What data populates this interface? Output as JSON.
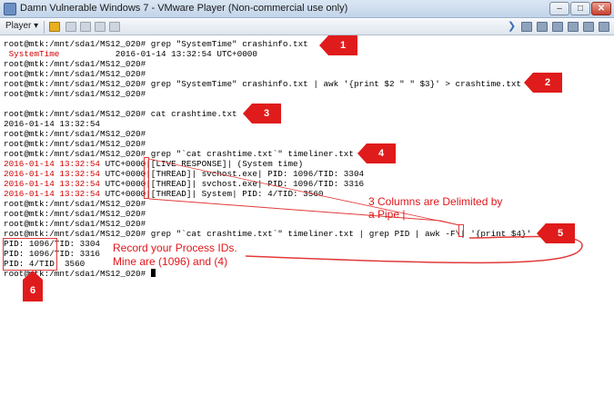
{
  "window": {
    "title": "Damn Vulnerable Windows 7 - VMware Player (Non-commercial use only)",
    "minimize_label": "–",
    "maximize_label": "□",
    "close_label": "✕"
  },
  "toolbar": {
    "player_menu": "Player ▾"
  },
  "terminal": {
    "lines": [
      "root@mtk:/mnt/sda1/MS12_020# grep \"SystemTime\" crashinfo.txt",
      "",
      "root@mtk:/mnt/sda1/MS12_020#",
      "root@mtk:/mnt/sda1/MS12_020#",
      "root@mtk:/mnt/sda1/MS12_020# grep \"SystemTime\" crashinfo.txt | awk '{print $2 \" \" $3}' > crashtime.txt",
      "root@mtk:/mnt/sda1/MS12_020#",
      "root@mtk:/mnt/sda1/MS12_020# cat crashtime.txt",
      "2016-01-14 13:32:54",
      "root@mtk:/mnt/sda1/MS12_020#",
      "root@mtk:/mnt/sda1/MS12_020#",
      "root@mtk:/mnt/sda1/MS12_020# grep \"`cat crashtime.txt`\" timeliner.txt",
      "",
      "",
      "",
      "",
      "root@mtk:/mnt/sda1/MS12_020#",
      "root@mtk:/mnt/sda1/MS12_020#",
      "root@mtk:/mnt/sda1/MS12_020#",
      "root@mtk:/mnt/sda1/MS12_020# grep \"`cat crashtime.txt`\" timeliner.txt | grep PID | awk -F\\| '{print $4}'",
      "PID: 1096/TID: 3304",
      "PID: 1096/TID: 3316",
      "PID: 4/TID: 3560",
      "root@mtk:/mnt/sda1/MS12_020# "
    ],
    "systemtime_key": " SystemTime",
    "systemtime_value": "           2016-01-14 13:32:54 UTC+0000",
    "timeliner_rows": [
      {
        "date": "2016-01-14 13:32:54",
        "rest": " UTC+0000|[LIVE RESPONSE]| (System time)"
      },
      {
        "date": "2016-01-14 13:32:54",
        "rest": " UTC+0000|[THREAD]| svchost.exe| PID: 1096/TID: 3304"
      },
      {
        "date": "2016-01-14 13:32:54",
        "rest": " UTC+0000|[THREAD]| svchost.exe| PID: 1096/TID: 3316"
      },
      {
        "date": "2016-01-14 13:32:54",
        "rest": " UTC+0000|[THREAD]| System| PID: 4/TID: 3560"
      }
    ]
  },
  "annotations": {
    "steps": [
      "1",
      "2",
      "3",
      "4",
      "5",
      "6"
    ],
    "columns_note_line1": "3 Columns are Delimited by",
    "columns_note_line2": "a Pipe |",
    "pids_note_line1": "Record your Process IDs.",
    "pids_note_line2": "Mine are (1096) and (4)"
  },
  "colors": {
    "annotation_red": "#e0161b",
    "terminal_red": "#d10000"
  }
}
